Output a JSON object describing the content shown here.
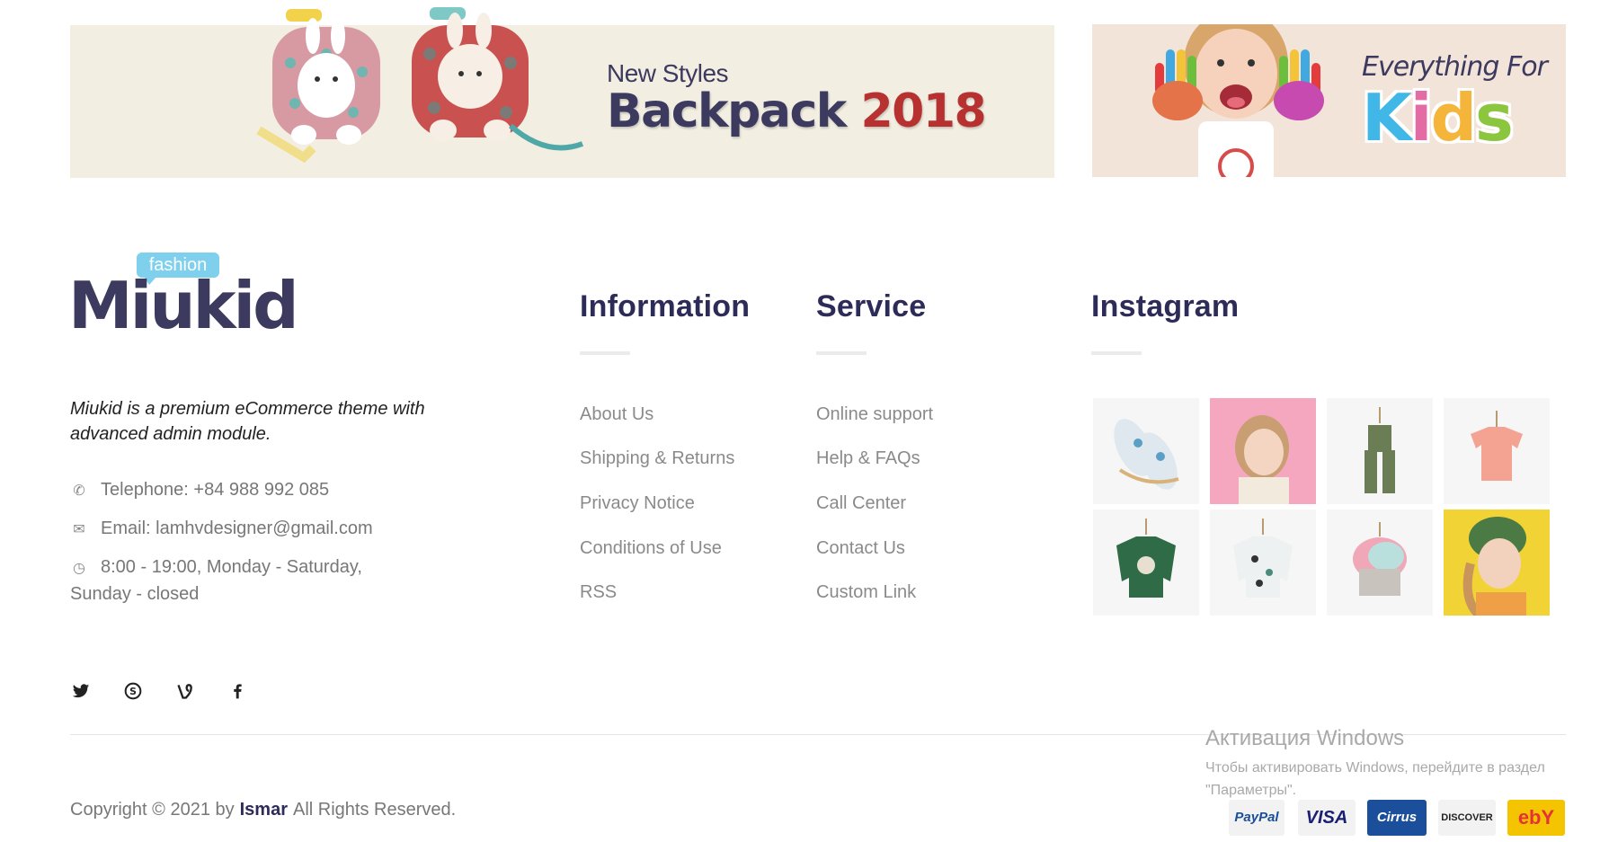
{
  "banners": {
    "left": {
      "subtitle": "New Styles",
      "title": "Backpack",
      "year": "2018"
    },
    "right": {
      "subtitle": "Everything For",
      "title": "Kids",
      "title_colors": [
        "#41b7e8",
        "#e46ca5",
        "#f4b53a",
        "#8cc63e"
      ]
    }
  },
  "logo": {
    "badge": "fashion",
    "name": "Miukid"
  },
  "about": {
    "description": "Miukid is a premium eCommerce theme with advanced admin module.",
    "telephone": "Telephone: +84 988 992 085",
    "email": "Email: lamhvdesigner@gmail.com",
    "hours": "8:00 - 19:00, Monday - Saturday, Sunday - closed"
  },
  "information": {
    "title": "Information",
    "links": [
      "About Us",
      "Shipping & Returns",
      "Privacy Notice",
      "Conditions of Use",
      "RSS"
    ]
  },
  "service": {
    "title": "Service",
    "links": [
      "Online support",
      "Help & FAQs",
      "Call Center",
      "Contact Us",
      "Custom Link"
    ]
  },
  "instagram": {
    "title": "Instagram",
    "items": [
      "baby-shoes",
      "girl-braids",
      "green-overalls",
      "pink-tshirt",
      "green-sweater",
      "white-sweater",
      "knit-hat",
      "girl-yellow"
    ]
  },
  "social": [
    "twitter-icon",
    "skype-icon",
    "vine-icon",
    "facebook-icon"
  ],
  "footer": {
    "copyright_prefix": "Copyright © 2021 by",
    "author": "Ismar",
    "copyright_suffix": "All Rights Reserved."
  },
  "windows_watermark": {
    "title": "Активация Windows",
    "line": "Чтобы активировать Windows, перейдите в раздел \"Параметры\"."
  },
  "payments": [
    "PayPal",
    "VISA",
    "Cirrus",
    "DISCOVER",
    "ebY"
  ],
  "colors": {
    "accent": "#2d2b57",
    "link": "#8a8a8a",
    "ebay_red": "#e53238"
  }
}
